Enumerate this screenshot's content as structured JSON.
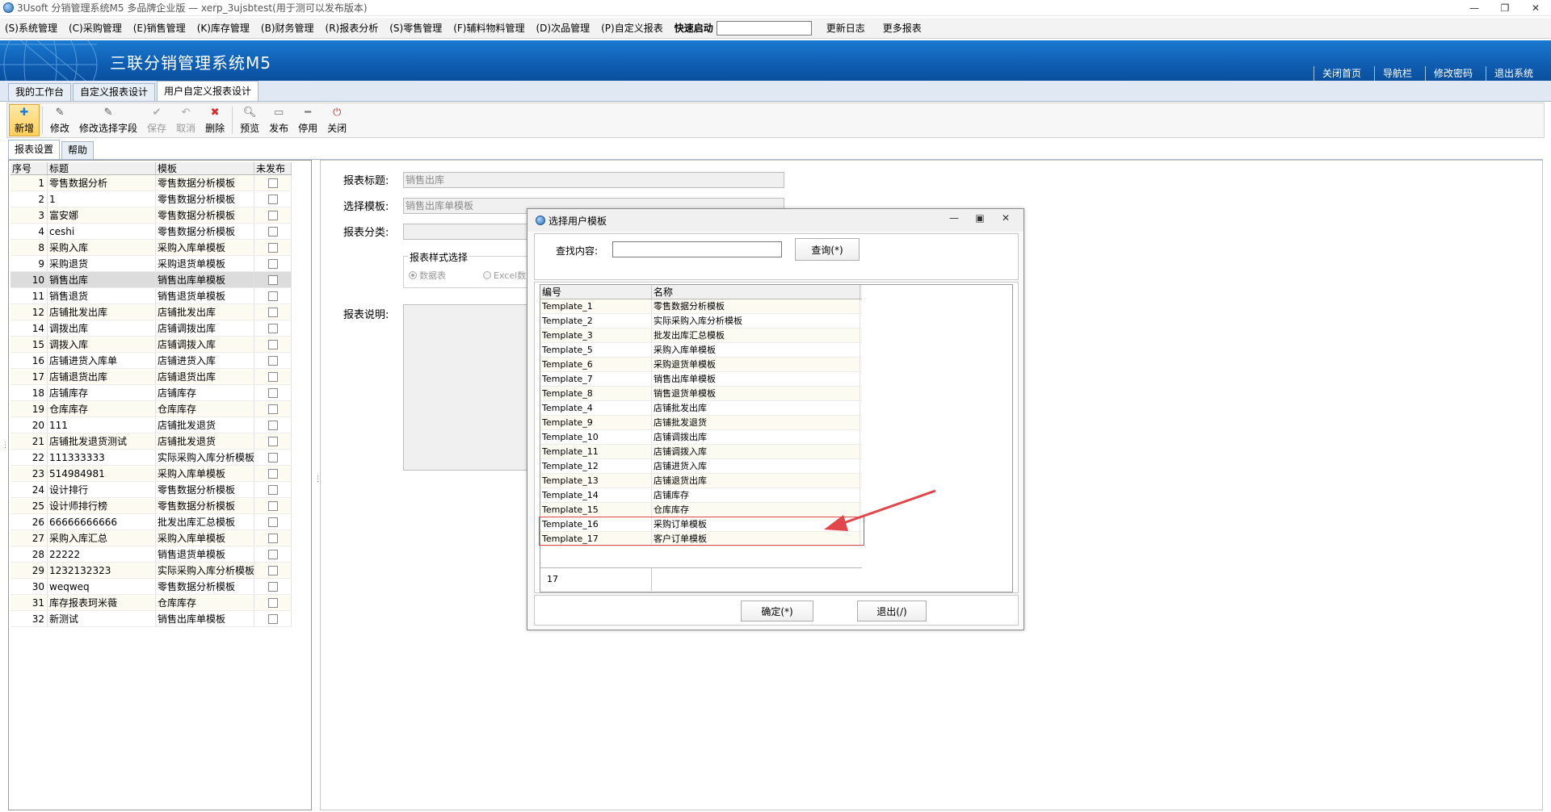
{
  "window": {
    "title": "3Usoft 分销管理系统M5 多品牌企业版 — xerp_3ujsbtest(用于测可以发布版本)"
  },
  "menu": {
    "items": [
      "(S)系统管理",
      "(C)采购管理",
      "(E)销售管理",
      "(K)库存管理",
      "(B)财务管理",
      "(R)报表分析",
      "(S)零售管理",
      "(F)辅料物料管理",
      "(D)次品管理",
      "(P)自定义报表"
    ],
    "quick_label": "快速启动",
    "quick_value": "",
    "right_links": [
      "更新日志",
      "更多报表"
    ]
  },
  "banner": {
    "brand": "三联分销管理系统M5",
    "links": [
      "关闭首页",
      "导航栏",
      "修改密码",
      "退出系统"
    ]
  },
  "top_tabs": [
    "我的工作台",
    "自定义报表设计",
    "用户自定义报表设计"
  ],
  "toolbar": {
    "buttons": [
      {
        "label": "新增",
        "icon": "add-icon",
        "state": "primary"
      },
      {
        "label": "修改",
        "icon": "edit-icon",
        "state": "normal"
      },
      {
        "label": "修改选择字段",
        "icon": "edit-fields-icon",
        "state": "normal"
      },
      {
        "label": "保存",
        "icon": "check-icon",
        "state": "disabled"
      },
      {
        "label": "取消",
        "icon": "undo-icon",
        "state": "disabled"
      },
      {
        "label": "删除",
        "icon": "delete-icon",
        "state": "normal"
      },
      {
        "label": "预览",
        "icon": "preview-icon",
        "state": "normal"
      },
      {
        "label": "发布",
        "icon": "publish-icon",
        "state": "normal"
      },
      {
        "label": "停用",
        "icon": "stop-icon",
        "state": "normal"
      },
      {
        "label": "关闭",
        "icon": "power-icon",
        "state": "normal"
      }
    ]
  },
  "sub_tabs": [
    "报表设置",
    "帮助"
  ],
  "left_grid": {
    "headers": [
      "序号",
      "标题",
      "模板",
      "未发布"
    ],
    "rows": [
      {
        "no": "1",
        "title": "零售数据分析",
        "template": "零售数据分析模板"
      },
      {
        "no": "2",
        "title": "1",
        "template": "零售数据分析模板"
      },
      {
        "no": "3",
        "title": "富安娜",
        "template": "零售数据分析模板"
      },
      {
        "no": "4",
        "title": "ceshi",
        "template": "零售数据分析模板"
      },
      {
        "no": "8",
        "title": "采购入库",
        "template": "采购入库单模板"
      },
      {
        "no": "9",
        "title": "采购退货",
        "template": "采购退货单模板"
      },
      {
        "no": "10",
        "title": "销售出库",
        "template": "销售出库单模板"
      },
      {
        "no": "11",
        "title": "销售退货",
        "template": "销售退货单模板"
      },
      {
        "no": "12",
        "title": "店铺批发出库",
        "template": "店铺批发出库"
      },
      {
        "no": "14",
        "title": "调拨出库",
        "template": "店铺调拨出库"
      },
      {
        "no": "15",
        "title": "调拨入库",
        "template": "店铺调拨入库"
      },
      {
        "no": "16",
        "title": "店铺进货入库单",
        "template": "店铺进货入库"
      },
      {
        "no": "17",
        "title": "店铺退货出库",
        "template": "店铺退货出库"
      },
      {
        "no": "18",
        "title": "店铺库存",
        "template": "店铺库存"
      },
      {
        "no": "19",
        "title": "仓库库存",
        "template": "仓库库存"
      },
      {
        "no": "20",
        "title": "111",
        "template": "店铺批发退货"
      },
      {
        "no": "21",
        "title": "店铺批发退货测试",
        "template": "店铺批发退货"
      },
      {
        "no": "22",
        "title": "111333333",
        "template": "实际采购入库分析模板"
      },
      {
        "no": "23",
        "title": "514984981",
        "template": "采购入库单模板"
      },
      {
        "no": "24",
        "title": "设计排行",
        "template": "零售数据分析模板"
      },
      {
        "no": "25",
        "title": "设计师排行榜",
        "template": "零售数据分析模板"
      },
      {
        "no": "26",
        "title": "66666666666",
        "template": "批发出库汇总模板"
      },
      {
        "no": "27",
        "title": "采购入库汇总",
        "template": "采购入库单模板"
      },
      {
        "no": "28",
        "title": "22222",
        "template": "销售退货单模板"
      },
      {
        "no": "29",
        "title": "1232132323",
        "template": "实际采购入库分析模板"
      },
      {
        "no": "30",
        "title": "weqweq",
        "template": "零售数据分析模板"
      },
      {
        "no": "31",
        "title": "库存报表珂米薇",
        "template": "仓库库存"
      },
      {
        "no": "32",
        "title": "新测试",
        "template": "销售出库单模板"
      }
    ]
  },
  "form": {
    "title_label": "报表标题:",
    "title_value": "销售出库",
    "template_label": "选择模板:",
    "template_value": "销售出库单模板",
    "category_label": "报表分类:",
    "category_value": "",
    "style_group": "报表样式选择",
    "style_options": [
      "数据表",
      "Excel数"
    ],
    "desc_label": "报表说明:"
  },
  "dialog": {
    "title": "选择用户模板",
    "search_label": "查找内容:",
    "search_value": "",
    "search_button": "查询(*)",
    "headers": [
      "编号",
      "名称"
    ],
    "rows": [
      {
        "code": "Template_1",
        "name": "零售数据分析模板"
      },
      {
        "code": "Template_2",
        "name": "实际采购入库分析模板"
      },
      {
        "code": "Template_3",
        "name": "批发出库汇总模板"
      },
      {
        "code": "Template_5",
        "name": "采购入库单模板"
      },
      {
        "code": "Template_6",
        "name": "采购退货单模板"
      },
      {
        "code": "Template_7",
        "name": "销售出库单模板"
      },
      {
        "code": "Template_8",
        "name": "销售退货单模板"
      },
      {
        "code": "Template_4",
        "name": "店铺批发出库"
      },
      {
        "code": "Template_9",
        "name": "店铺批发退货"
      },
      {
        "code": "Template_10",
        "name": "店铺调拨出库"
      },
      {
        "code": "Template_11",
        "name": "店铺调拨入库"
      },
      {
        "code": "Template_12",
        "name": "店铺进货入库"
      },
      {
        "code": "Template_13",
        "name": "店铺退货出库"
      },
      {
        "code": "Template_14",
        "name": "店铺库存"
      },
      {
        "code": "Template_15",
        "name": "仓库库存"
      },
      {
        "code": "Template_16",
        "name": "采购订单模板"
      },
      {
        "code": "Template_17",
        "name": "客户订单模板"
      }
    ],
    "count": "17",
    "ok_button": "确定(*)",
    "exit_button": "退出(/)"
  },
  "colors": {
    "banner": "#0f5fb4",
    "highlight": "#e0464a",
    "primary_button": "#ffcf5a"
  }
}
